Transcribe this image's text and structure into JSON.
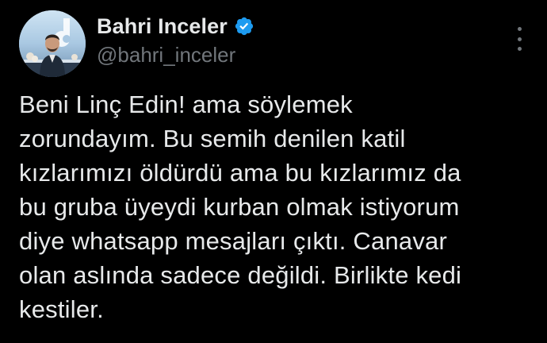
{
  "tweet": {
    "author": {
      "display_name": "Bahri Inceler",
      "handle": "@bahri_inceler",
      "verified": true,
      "verified_icon": "verified-badge-icon",
      "avatar_icon": "avatar-photo"
    },
    "more_icon": "more-options-icon",
    "text": "Beni Linç Edin! ama söylemek\nzorundayım. Bu semih denilen katil\nkızlarımızı öldürdü ama bu kızlarımız da\nbu gruba üyeydi kurban olmak istiyorum\ndiye whatsapp mesajları çıktı. Canavar\nolan aslında sadece değildi. Birlikte kedi\nkestiler."
  },
  "colors": {
    "background": "#000000",
    "primary_text": "#e7e9ea",
    "secondary_text": "#71767b",
    "verified_blue": "#1d9bf0"
  }
}
